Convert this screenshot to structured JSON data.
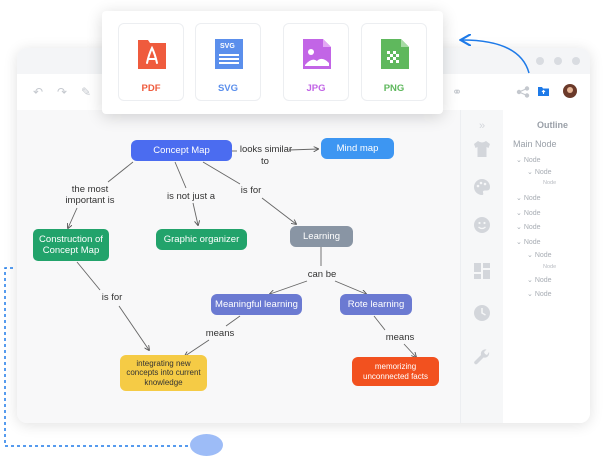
{
  "export_menu": {
    "options": [
      {
        "label": "PDF",
        "color": "#ef5b3d"
      },
      {
        "label": "SVG",
        "color": "#5b8fec",
        "icon_text": "SVG"
      },
      {
        "label": "JPG",
        "color": "#c265e6"
      },
      {
        "label": "PNG",
        "color": "#5fb85d"
      }
    ]
  },
  "concept_map": {
    "nodes": {
      "concept_map": "Concept Map",
      "mind_map": "Mind map",
      "construction": "Construction of Concept Map",
      "graphic_organizer": "Graphic organizer",
      "learning": "Learning",
      "meaningful": "Meaningful learning",
      "rote": "Rote learning",
      "integrating": "integrating new concepts into current knowledge",
      "memorizing": "memorizing unconnected facts"
    },
    "links": {
      "looks_similar": "looks similar",
      "looks_similar_to": "to",
      "most_important_1": "the most",
      "most_important_2": "important is",
      "not_just": "is not just a",
      "is_for_1": "is for",
      "is_for_2": "is for",
      "can_be": "can be",
      "means_1": "means",
      "means_2": "means"
    }
  },
  "outline": {
    "title": "Outline",
    "root": "Main Node",
    "items": [
      {
        "label": "Node"
      },
      {
        "label": "Node"
      },
      {
        "label": "Node"
      },
      {
        "label": "Node"
      },
      {
        "label": "Node"
      },
      {
        "label": "Node"
      },
      {
        "label": "Node"
      },
      {
        "label": "Node"
      },
      {
        "label": "Node"
      },
      {
        "label": "Node"
      },
      {
        "label": "Node"
      },
      {
        "label": "Node"
      },
      {
        "label": "Node"
      }
    ]
  },
  "colors": {
    "accent_blue": "#1e7ae8",
    "concept_map_node": "#4b6cf0",
    "mind_map_node": "#3d96f2",
    "green_nodes": "#22a36b",
    "learning_node": "#8995a4",
    "meaningful_nodes": "#6b7ad2",
    "yellow_node": "#f5cb45",
    "orange_node": "#f2511f"
  },
  "icons": [
    "undo-icon",
    "redo-icon",
    "brush-icon",
    "link-icon",
    "share-icon",
    "export-icon",
    "avatar",
    "chevrons-icon",
    "shirt-icon",
    "palette-icon",
    "emoji-icon",
    "layout-icon",
    "clock-icon",
    "wrench-icon"
  ]
}
